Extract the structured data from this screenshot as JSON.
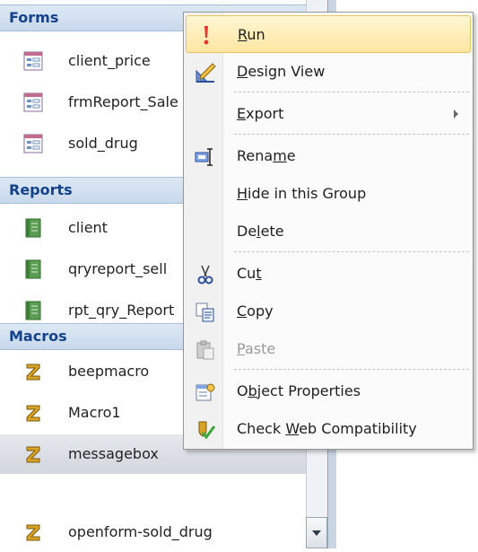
{
  "nav_pane": {
    "groups": [
      {
        "title": "Forms",
        "items": [
          {
            "label": "client_price",
            "icon": "form-icon"
          },
          {
            "label": "frmReport_Sale",
            "icon": "form-icon"
          },
          {
            "label": "sold_drug",
            "icon": "form-icon"
          }
        ]
      },
      {
        "title": "Reports",
        "items": [
          {
            "label": "client",
            "icon": "report-icon"
          },
          {
            "label": "qryreport_sell",
            "icon": "report-icon"
          },
          {
            "label": "rpt_qry_Report",
            "icon": "report-icon"
          }
        ]
      },
      {
        "title": "Macros",
        "items": [
          {
            "label": "beepmacro",
            "icon": "macro-icon"
          },
          {
            "label": "Macro1",
            "icon": "macro-icon"
          },
          {
            "label": "messagebox",
            "icon": "macro-icon",
            "selected": true
          },
          {
            "label": "openform-sold_drug",
            "icon": "macro-icon"
          }
        ]
      }
    ]
  },
  "context_menu": {
    "items": [
      {
        "pre": "",
        "key": "R",
        "post": "un",
        "icon": "exclamation-run-icon",
        "highlighted": true
      },
      {
        "pre": "",
        "key": "D",
        "post": "esign View",
        "icon": "design-view-icon"
      },
      {
        "pre": "",
        "key": "E",
        "post": "xport",
        "icon": "",
        "submenu": true
      },
      {
        "pre": "Rena",
        "key": "m",
        "post": "e",
        "icon": "rename-icon"
      },
      {
        "pre": "",
        "key": "H",
        "post": "ide in this Group",
        "icon": ""
      },
      {
        "pre": "De",
        "key": "l",
        "post": "ete",
        "icon": ""
      },
      {
        "pre": "Cu",
        "key": "t",
        "post": "",
        "icon": "scissors-icon"
      },
      {
        "pre": "",
        "key": "C",
        "post": "opy",
        "icon": "copy-icon"
      },
      {
        "pre": "",
        "key": "P",
        "post": "aste",
        "icon": "paste-icon",
        "disabled": true
      },
      {
        "pre": "O",
        "key": "b",
        "post": "ject Properties",
        "icon": "properties-icon"
      },
      {
        "pre": "Check ",
        "key": "W",
        "post": "eb Compatibility",
        "icon": "web-compat-icon"
      }
    ]
  }
}
